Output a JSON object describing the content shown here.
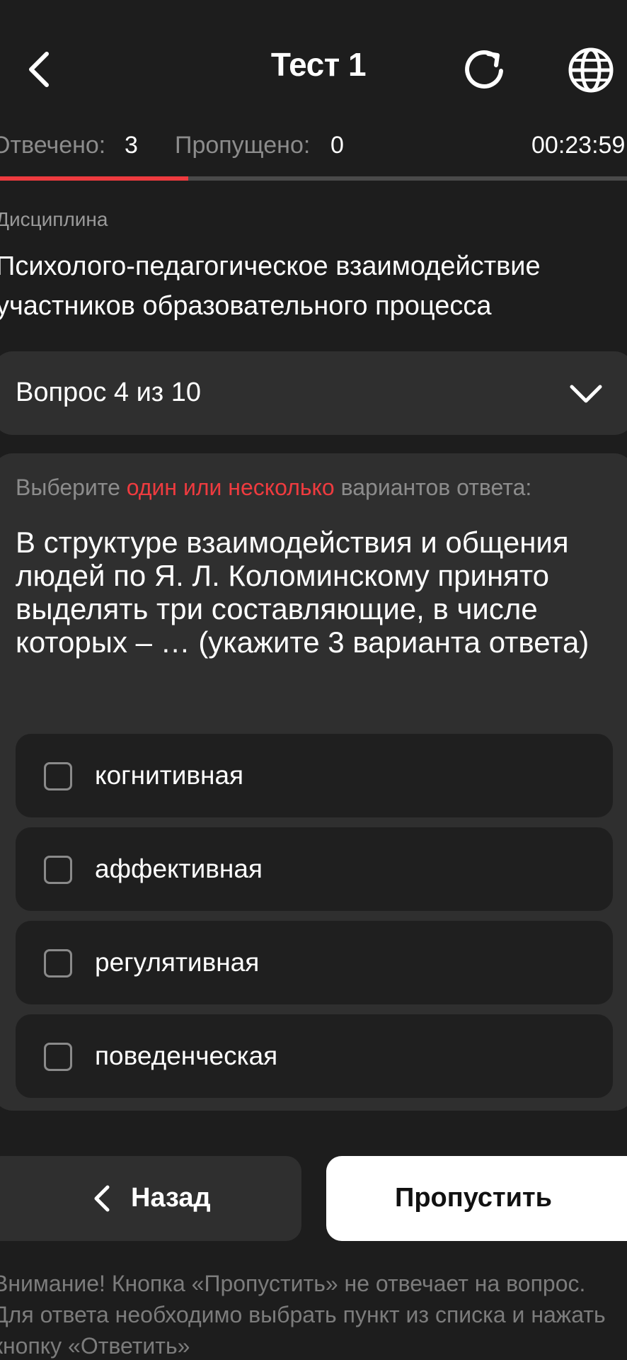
{
  "header": {
    "title": "Тест 1",
    "back_icon": "chevron-left-icon",
    "refresh_icon": "refresh-icon",
    "language_icon": "globe-icon"
  },
  "status": {
    "answered_label": "Отвечено:",
    "answered_value": "3",
    "skipped_label": "Пропущено:",
    "skipped_value": "0",
    "timer": "00:23:59",
    "progress_fraction": 0.3
  },
  "discipline": {
    "label": "Дисциплина",
    "name": "Психолого-педагогическое взаимодействие участников образовательного процесса"
  },
  "question_selector": {
    "label": "Вопрос 4 из 10"
  },
  "question": {
    "instruction_prefix": "Выберите ",
    "instruction_accent": "один или несколько",
    "instruction_suffix": " вариантов ответа:",
    "text": "В структуре взаимодействия и общения людей по Я. Л. Коломинскому принято выделять три составляющие, в числе которых – … (укажите 3 варианта ответа)",
    "options": [
      {
        "label": "когнитивная",
        "checked": false
      },
      {
        "label": "аффективная",
        "checked": false
      },
      {
        "label": "регулятивная",
        "checked": false
      },
      {
        "label": "поведенческая",
        "checked": false
      }
    ]
  },
  "buttons": {
    "back_label": "Назад",
    "skip_label": "Пропустить"
  },
  "notice": "Внимание! Кнопка «Пропустить» не отвечает на вопрос. Для ответа необходимо выбрать пункт из списка и нажать кнопку «Ответить»",
  "colors": {
    "background": "#1d1d1d",
    "card": "#2f2f2f",
    "accent": "#ee3b3f",
    "primary_button": "#ffffff"
  }
}
